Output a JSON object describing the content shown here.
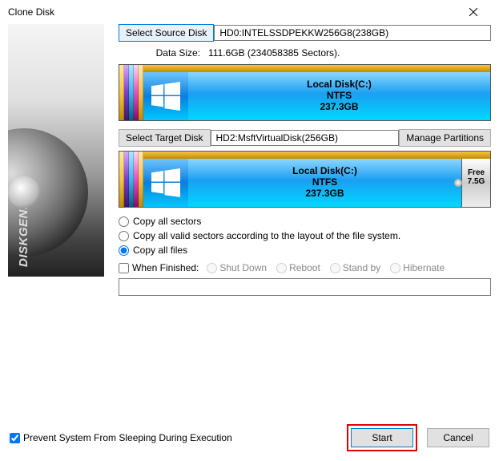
{
  "title": "Clone Disk",
  "brand": "DISKGENIUS",
  "source": {
    "btn": "Select Source Disk",
    "value": "HD0:INTELSSDPEKKW256G8(238GB)",
    "data_size_label": "Data Size:",
    "data_size_value": "111.6GB (234058385 Sectors)."
  },
  "source_disk": {
    "name": "Local Disk(C:)",
    "fs": "NTFS",
    "size": "237.3GB"
  },
  "target": {
    "btn": "Select Target Disk",
    "value": "HD2:MsftVirtualDisk(256GB)",
    "manage_btn": "Manage Partitions"
  },
  "target_disk": {
    "name": "Local Disk(C:)",
    "fs": "NTFS",
    "size": "237.3GB",
    "free_label": "Free",
    "free_size": "7.5G"
  },
  "copy_options": {
    "all_sectors": "Copy all sectors",
    "valid_sectors": "Copy all valid sectors according to the layout of the file system.",
    "all_files": "Copy all files"
  },
  "finished": {
    "label": "When Finished:",
    "shutdown": "Shut Down",
    "reboot": "Reboot",
    "standby": "Stand by",
    "hibernate": "Hibernate"
  },
  "footer": {
    "prevent_sleep": "Prevent System From Sleeping During Execution",
    "start": "Start",
    "cancel": "Cancel"
  }
}
